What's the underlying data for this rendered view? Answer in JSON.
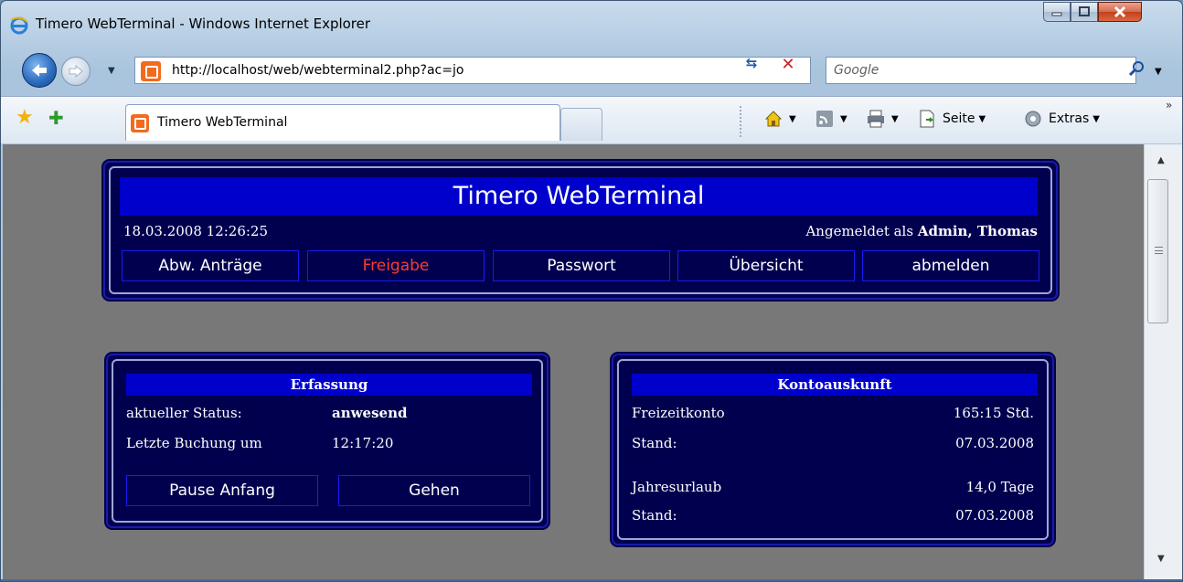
{
  "window": {
    "title": "Timero WebTerminal - Windows Internet Explorer"
  },
  "navbar": {
    "address": "http://localhost/web/webterminal2.php?ac=jo",
    "search_placeholder": "Google"
  },
  "tabbar": {
    "tab_label": "Timero WebTerminal",
    "commands": {
      "page_label": "Seite",
      "tools_label": "Extras"
    }
  },
  "header": {
    "title": "Timero WebTerminal",
    "datetime": "18.03.2008 12:26:25",
    "logged_in_prefix": "Angemeldet als",
    "logged_in_user": "Admin, Thomas",
    "nav": [
      {
        "label": "Abw. Anträge",
        "active": false
      },
      {
        "label": "Freigabe",
        "active": true
      },
      {
        "label": "Passwort",
        "active": false
      },
      {
        "label": "Übersicht",
        "active": false
      },
      {
        "label": "abmelden",
        "active": false
      }
    ]
  },
  "erfassung": {
    "title": "Erfassung",
    "status_label": "aktueller Status:",
    "status_value": "anwesend",
    "last_label": "Letzte Buchung um",
    "last_value": "12:17:20",
    "buttons": {
      "pause": "Pause Anfang",
      "go": "Gehen"
    }
  },
  "konto": {
    "title": "Kontoauskunft",
    "rows": [
      {
        "label": "Freizeitkonto",
        "value": "165:15 Std."
      },
      {
        "label": "Stand:",
        "value": "07.03.2008"
      },
      {
        "label": "Jahresurlaub",
        "value": "14,0 Tage"
      },
      {
        "label": "Stand:",
        "value": "07.03.2008"
      }
    ]
  },
  "colors": {
    "panel_bg": "#00004f",
    "title_bar_bg": "#0000cc",
    "active_nav": "#ff3b30",
    "page_bg": "#787878"
  }
}
